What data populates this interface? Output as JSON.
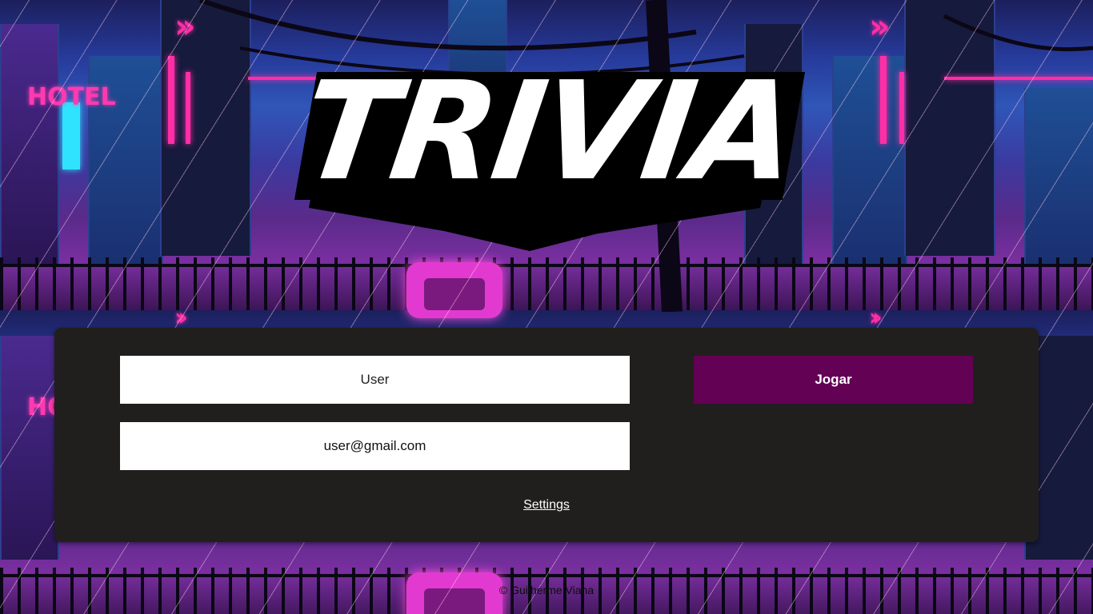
{
  "logo": {
    "title": "TRIVIA"
  },
  "background": {
    "sign_text": "HOTEL",
    "accent_pink": "#ff2ea6",
    "accent_cyan": "#2fe3ff"
  },
  "form": {
    "name_input": {
      "value": "",
      "placeholder": "User"
    },
    "email_input": {
      "value": "user@gmail.com",
      "placeholder": ""
    },
    "play_button_label": "Jogar",
    "play_button_color": "#630154",
    "settings_link_label": "Settings"
  },
  "footer": {
    "credit": "© Guilherme Viana"
  }
}
